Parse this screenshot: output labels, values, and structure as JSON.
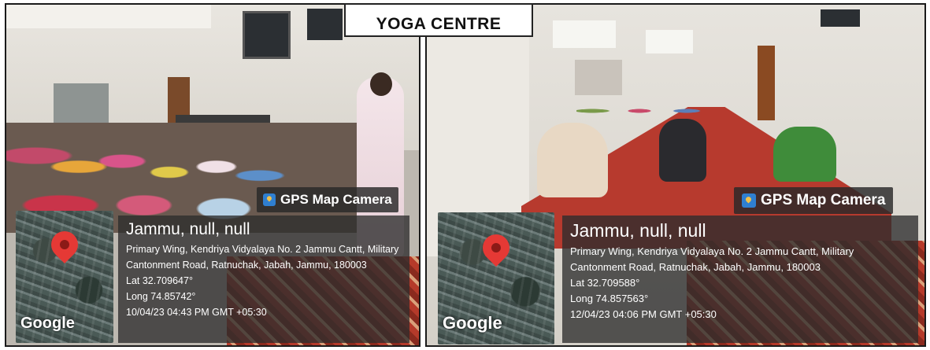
{
  "title": "YOGA CENTRE",
  "photos": [
    {
      "badge": "GPS Map Camera",
      "map_logo": "Google",
      "map_marker": "red-location-pin",
      "location": "Jammu, null, null",
      "address_line1": "Primary Wing, Kendriya Vidyalaya No. 2 Jammu Cantt, Military",
      "address_line2": "Cantonment Road, Ratnuchak, Jabah, Jammu, 180003",
      "latitude": "Lat 32.709647°",
      "longitude": "Long 74.85742°",
      "timestamp": "10/04/23 04:43 PM GMT +05:30"
    },
    {
      "badge": "GPS Map Camera",
      "map_logo": "Google",
      "map_marker": "red-location-pin",
      "location": "Jammu, null, null",
      "address_line1": "Primary Wing, Kendriya Vidyalaya No. 2 Jammu Cantt, Military",
      "address_line2": "Cantonment Road, Ratnuchak, Jabah, Jammu, 180003",
      "latitude": "Lat 32.709588°",
      "longitude": "Long 74.857563°",
      "timestamp": "12/04/23 04:06 PM GMT +05:30"
    }
  ],
  "colors": {
    "overlay": "#2d2d2d",
    "pin": "#e53935",
    "badge_icon": "#2f7fd0",
    "carpet": "#c0392b"
  }
}
